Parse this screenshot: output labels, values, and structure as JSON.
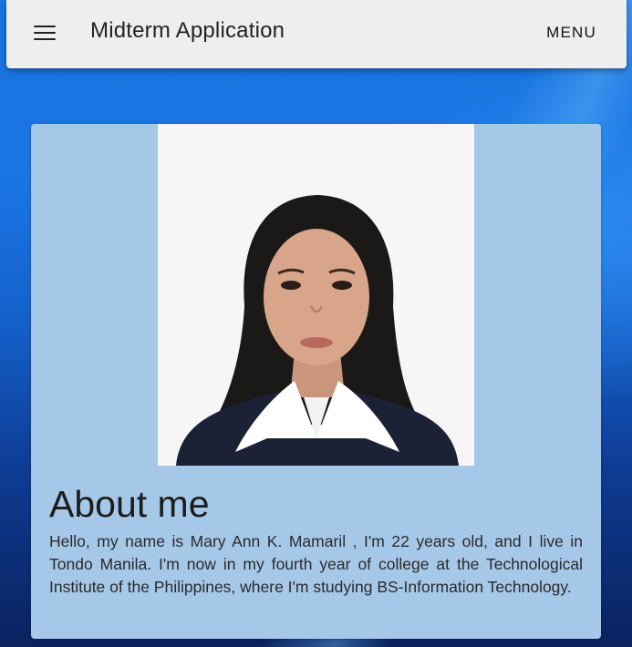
{
  "app_bar": {
    "title": "Midterm Application",
    "menu_label": "MENU",
    "menu_icon": "hamburger-menu-icon"
  },
  "card": {
    "photo_alt": "Portrait of Mary Ann K. Mamaril",
    "heading": "About me",
    "body": "Hello, my name is Mary Ann K. Mamaril , I'm 22 years old, and I live in Tondo Manila. I'm now in my fourth year of college at the Technological Institute of the Philippines, where I'm studying BS-Information Technology."
  },
  "colors": {
    "app_bar_bg": "#eeeeee",
    "card_bg": "#a6c8e8",
    "background_blue": "#1a73e3"
  }
}
